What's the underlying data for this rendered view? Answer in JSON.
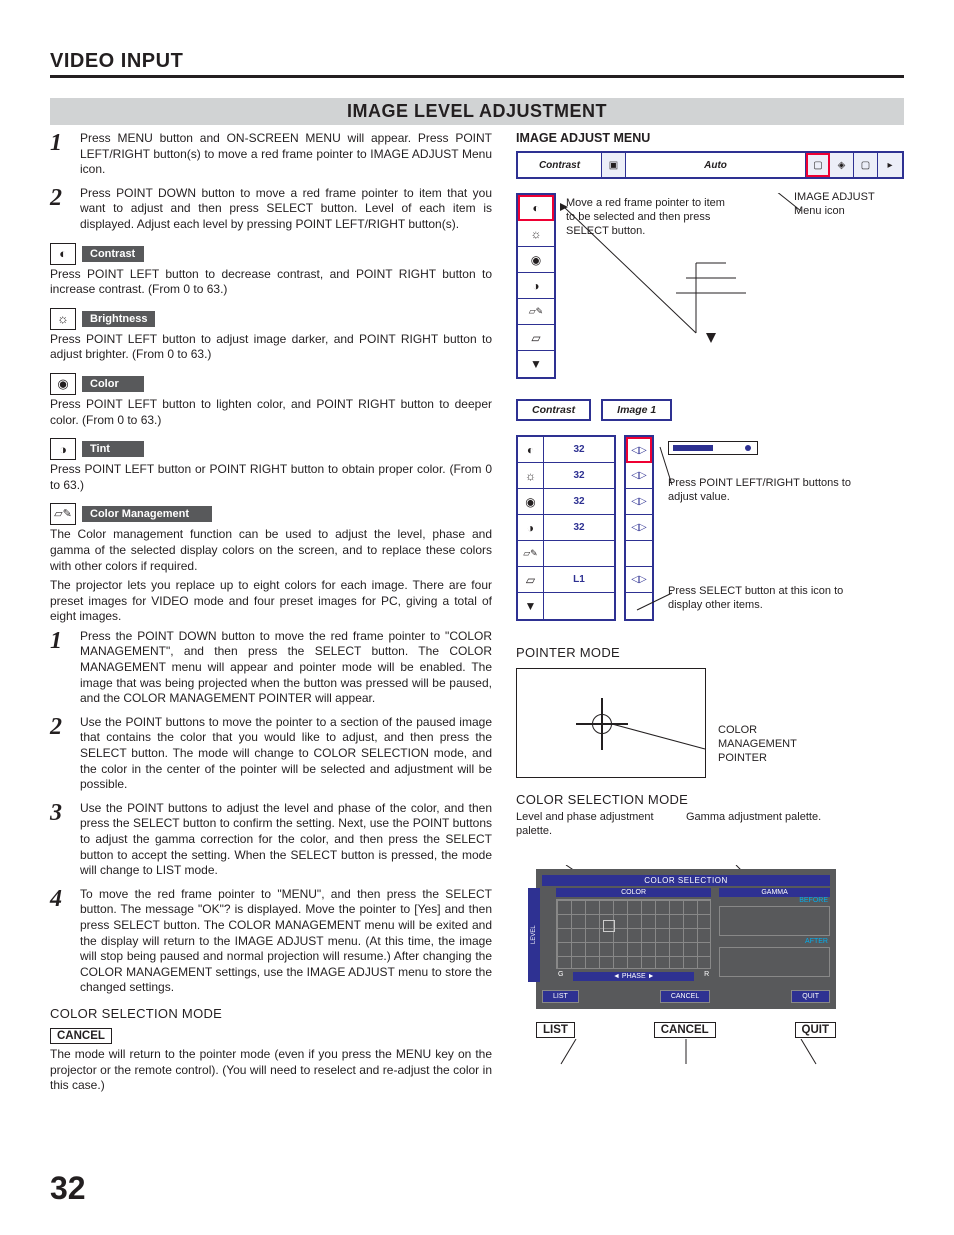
{
  "header": {
    "section": "VIDEO INPUT",
    "title": "IMAGE LEVEL ADJUSTMENT",
    "page_number": "32"
  },
  "intro_steps": [
    {
      "n": "1",
      "text": "Press MENU button and ON-SCREEN MENU will appear. Press POINT LEFT/RIGHT button(s) to move a red frame pointer to IMAGE ADJUST Menu icon."
    },
    {
      "n": "2",
      "text": "Press POINT DOWN button to move a red frame pointer to item that you want to adjust and then press SELECT button. Level of each item is displayed.  Adjust each level by pressing POINT LEFT/RIGHT button(s)."
    }
  ],
  "params": {
    "contrast": {
      "label": "Contrast",
      "desc": "Press POINT LEFT button to decrease contrast, and POINT RIGHT button to increase contrast.  (From 0 to 63.)"
    },
    "brightness": {
      "label": "Brightness",
      "desc": "Press POINT LEFT button to adjust image darker, and POINT RIGHT button to adjust brighter.  (From 0 to 63.)"
    },
    "color": {
      "label": "Color",
      "desc": "Press POINT LEFT button to lighten color, and POINT RIGHT button to deeper color.  (From 0 to 63.)"
    },
    "tint": {
      "label": "Tint",
      "desc": "Press POINT LEFT button or POINT RIGHT button to obtain proper color.  (From 0 to 63.)"
    },
    "cm": {
      "label": "Color Management",
      "desc1": "The Color management function can be used to adjust the level, phase and gamma of the selected display colors on the screen, and to replace these colors with other colors if required.",
      "desc2": "The projector lets you replace up to eight colors for each image. There are four preset images for VIDEO mode and four preset images for PC, giving a total of eight images."
    }
  },
  "cm_steps": [
    {
      "n": "1",
      "text": "Press the POINT DOWN button to move the red frame pointer to \"COLOR MANAGEMENT\", and then press the SELECT button. The COLOR MANAGEMENT menu will appear and pointer mode will be enabled. The image that was being projected when the button was pressed will be paused, and the COLOR MANAGEMENT POINTER will appear."
    },
    {
      "n": "2",
      "text": "Use the POINT buttons to move the pointer to a section of the paused image that contains the color that you would like to adjust, and then press the SELECT button. The mode will change to COLOR SELECTION mode, and the color in the center of the pointer will be selected and adjustment will be possible."
    },
    {
      "n": "3",
      "text": "Use the POINT buttons to adjust the level and phase of the color, and then press the SELECT button to confirm the setting. Next, use the POINT buttons to adjust the gamma correction for the color, and then press the SELECT button to accept the setting. When the SELECT button is pressed, the mode will change to LIST mode."
    },
    {
      "n": "4",
      "text": "To move the red frame pointer to \"MENU\", and then press the SELECT button. The message \"OK\"? is displayed. Move the pointer to [Yes] and then press SELECT button. The COLOR MANAGEMENT menu will be exited and the display will return to the IMAGE ADJUST menu. (At this time, the image will stop being paused and normal projection will resume.) After changing the COLOR MANAGEMENT settings, use the IMAGE ADJUST menu to store the changed settings."
    }
  ],
  "csm": {
    "heading": "COLOR SELECTION MODE",
    "cancel_label": "CANCEL",
    "cancel_desc": "The mode will return to the pointer mode (even if you press the MENU key on the projector or the remote control). (You will need to reselect and re-adjust the color in this case.)"
  },
  "right": {
    "menu_title": "IMAGE ADJUST MENU",
    "topbar": {
      "contrast": "Contrast",
      "auto": "Auto"
    },
    "note1": "Move a red frame pointer to item to be selected and then press SELECT button.",
    "icon_label": "IMAGE ADJUST Menu icon",
    "pair": {
      "contrast": "Contrast",
      "image1": "Image 1"
    },
    "adjust_values": {
      "v1": "32",
      "v2": "32",
      "v3": "32",
      "v4": "32",
      "l1": "L1"
    },
    "note2": "Press POINT LEFT/RIGHT buttons to adjust value.",
    "note3": "Press SELECT button at this icon to display other items.",
    "pointer_mode": "POINTER MODE",
    "pointer_label": "COLOR MANAGEMENT POINTER",
    "cs_mode": "COLOR SELECTION MODE",
    "level_phase": "Level and phase adjustment palette.",
    "gamma": "Gamma adjustment palette.",
    "cs_panel": {
      "title": "COLOR SELECTION",
      "color": "COLOR",
      "gamma_lbl": "GAMMA",
      "before": "BEFORE",
      "after": "AFTER",
      "level": "LEVEL",
      "phase": "◄ PHASE ►",
      "g": "G",
      "r": "R",
      "list": "LIST",
      "cancel": "CANCEL",
      "quit": "QUIT"
    },
    "outline": {
      "list": "LIST",
      "cancel": "CANCEL",
      "quit": "QUIT"
    }
  }
}
